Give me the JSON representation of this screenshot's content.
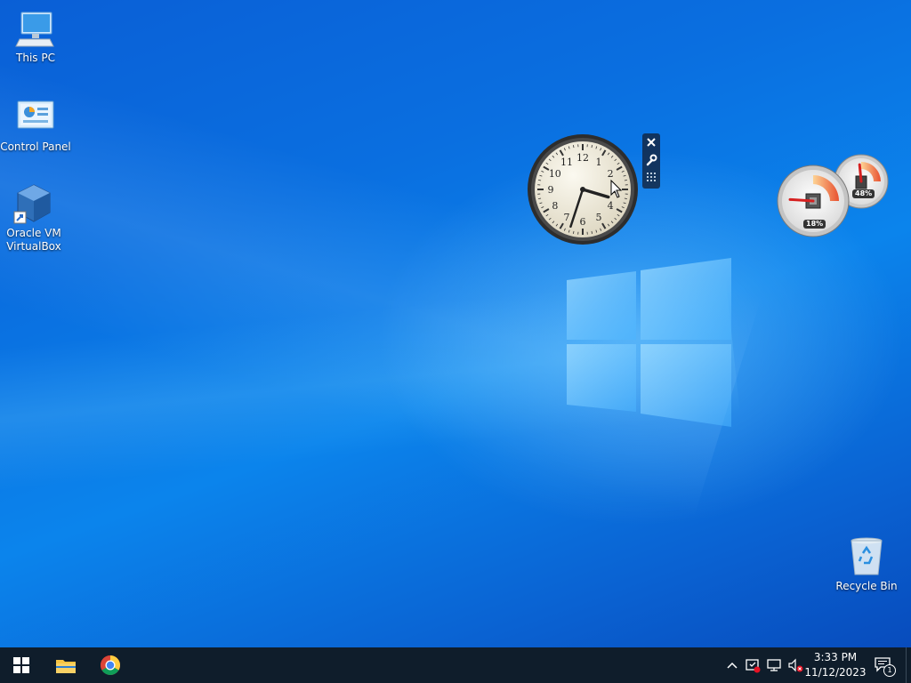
{
  "desktop": {
    "icons": [
      {
        "label": "This PC",
        "icon": "computer-icon"
      },
      {
        "label": "Control Panel",
        "icon": "control-panel-icon"
      },
      {
        "label": "Oracle VM VirtualBox",
        "icon": "virtualbox-icon"
      },
      {
        "label": "Recycle Bin",
        "icon": "recycle-bin-icon"
      }
    ]
  },
  "gadgets": {
    "clock": {
      "hour": 3,
      "minute": 33
    },
    "cpu_meter": {
      "cpu_percent": "18%",
      "memory_percent": "48%",
      "cpu_value": 18,
      "memory_value": 48
    }
  },
  "taskbar": {
    "pinned": [
      {
        "name": "start",
        "icon": "windows-start-icon"
      },
      {
        "name": "file-explorer",
        "icon": "folder-icon"
      },
      {
        "name": "chrome",
        "icon": "chrome-icon"
      }
    ],
    "tray": {
      "icons": [
        "chevron-up-icon",
        "security-alert-icon",
        "network-icon",
        "volume-muted-icon"
      ],
      "time": "3:33 PM",
      "date": "11/12/2023",
      "notification_count": "1"
    }
  },
  "colors": {
    "taskbar": "#0f1d2b",
    "wallpaper_blue": "#0a6fe0"
  }
}
